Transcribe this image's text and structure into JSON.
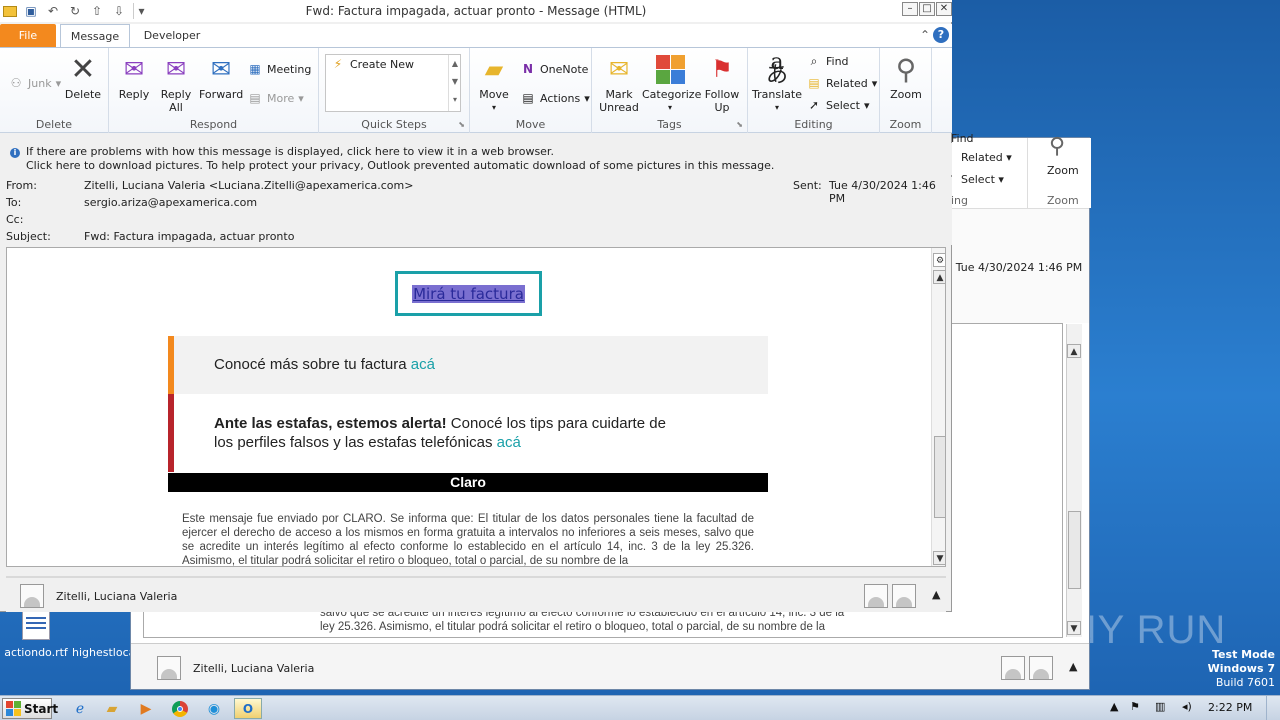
{
  "window": {
    "title": "Fwd: Factura impagada, actuar pronto  -  Message (HTML)",
    "controls": [
      "–",
      "□",
      "✕"
    ]
  },
  "qat": {
    "icons": [
      "outlook-icon",
      "save-icon",
      "undo-icon",
      "redo-icon",
      "up-icon",
      "down-icon",
      "customize-icon"
    ]
  },
  "tabs": {
    "file": "File",
    "message": "Message",
    "developer": "Developer"
  },
  "ribbon": {
    "groups": {
      "delete": "Delete",
      "respond": "Respond",
      "quick_steps": "Quick Steps",
      "move": "Move",
      "tags": "Tags",
      "editing": "Editing",
      "zoom": "Zoom"
    },
    "junk": "Junk",
    "delete": "Delete",
    "reply": "Reply",
    "reply_all_1": "Reply",
    "reply_all_2": "All",
    "forward": "Forward",
    "meeting": "Meeting",
    "more": "More",
    "create_new": "Create New",
    "move": "Move",
    "onenote": "OneNote",
    "actions": "Actions",
    "mark_unread_1": "Mark",
    "mark_unread_2": "Unread",
    "categorize": "Categorize",
    "follow_up_1": "Follow",
    "follow_up_2": "Up",
    "translate": "Translate",
    "find": "Find",
    "related": "Related",
    "select": "Select",
    "zoom": "Zoom"
  },
  "infobar": {
    "line1": "If there are problems with how this message is displayed, click here to view it in a web browser.",
    "line2": "Click here to download pictures. To help protect your privacy, Outlook prevented automatic download of some pictures in this message."
  },
  "headers": {
    "from_label": "From:",
    "from_value": "Zitelli, Luciana Valeria <Luciana.Zitelli@apexamerica.com>",
    "sent_label": "Sent:",
    "sent_value": "Tue 4/30/2024 1:46 PM",
    "to_label": "To:",
    "to_value": "sergio.ariza@apexamerica.com",
    "cc_label": "Cc:",
    "subject_label": "Subject:",
    "subject_value": "Fwd: Factura impagada, actuar pronto"
  },
  "email": {
    "cta": "Mirá tu factura",
    "band1_text": "Conocé más sobre tu factura ",
    "band1_link": "acá",
    "band2_bold": "Ante las estafas, estemos alerta!",
    "band2_text1": " Conocé los tips para cuidarte de",
    "band2_text2": "los perfiles falsos y las estafas telefónicas ",
    "band2_link": "acá",
    "brand": "Claro",
    "legal": "Este mensaje fue enviado por CLARO. Se informa que: El titular de los datos personales tiene la facultad de ejercer el derecho de acceso a los mismos en forma gratuita a intervalos no inferiores a seis meses, salvo que se acredite un interés legítimo al efecto conforme lo establecido en el artículo 14, inc. 3 de la ley 25.326. Asimismo, el titular podrá solicitar el retiro o bloqueo, total o parcial, de su nombre de la"
  },
  "footer": {
    "name": "Zitelli, Luciana Valeria"
  },
  "background_window": {
    "find": "Find",
    "related": "Related",
    "select": "Select",
    "zoom": "Zoom",
    "group_editing": "ing",
    "group_zoom": "Zoom",
    "sent_value": "Tue 4/30/2024 1:46 PM",
    "legal_line1": "salvo que se acredite un interés legítimo al efecto conforme lo establecido en el artículo 14, inc. 3 de la",
    "legal_line2": "ley 25.326. Asimismo, el titular podrá solicitar el retiro o bloqueo, total o parcial, de su nombre de la",
    "footer_name": "Zitelli, Luciana Valeria"
  },
  "desktop": {
    "icon1": "actiondo.rtf",
    "icon2": "highestloca",
    "watermark": "ANY RUN",
    "test_mode": "Test Mode",
    "os": "Windows 7",
    "build": "Build 7601"
  },
  "taskbar": {
    "start": "Start",
    "clock": "2:22 PM"
  },
  "colors": {
    "file_tab": "#f3891e",
    "cta_border": "#1aa0a8",
    "link": "#1aa0a8",
    "band1_accent": "#f3891e",
    "band2_accent": "#b8242b"
  }
}
